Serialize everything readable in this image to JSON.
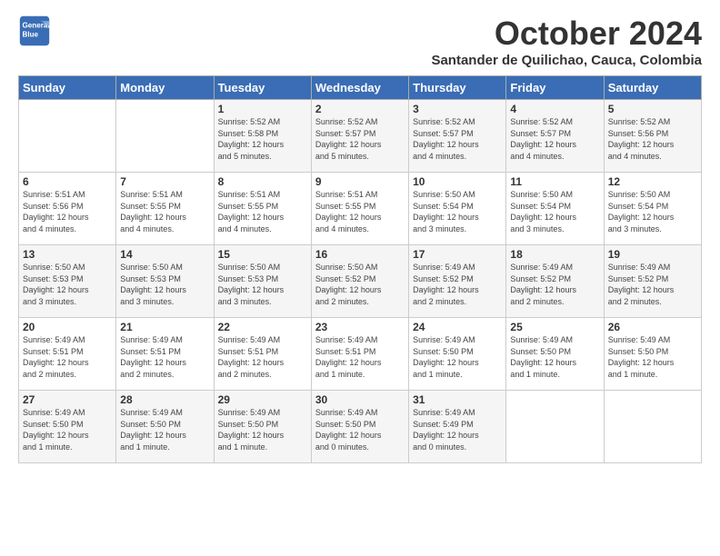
{
  "logo": {
    "line1": "General",
    "line2": "Blue"
  },
  "title": "October 2024",
  "subtitle": "Santander de Quilichao, Cauca, Colombia",
  "headers": [
    "Sunday",
    "Monday",
    "Tuesday",
    "Wednesday",
    "Thursday",
    "Friday",
    "Saturday"
  ],
  "weeks": [
    [
      {
        "day": "",
        "info": ""
      },
      {
        "day": "",
        "info": ""
      },
      {
        "day": "1",
        "info": "Sunrise: 5:52 AM\nSunset: 5:58 PM\nDaylight: 12 hours\nand 5 minutes."
      },
      {
        "day": "2",
        "info": "Sunrise: 5:52 AM\nSunset: 5:57 PM\nDaylight: 12 hours\nand 5 minutes."
      },
      {
        "day": "3",
        "info": "Sunrise: 5:52 AM\nSunset: 5:57 PM\nDaylight: 12 hours\nand 4 minutes."
      },
      {
        "day": "4",
        "info": "Sunrise: 5:52 AM\nSunset: 5:57 PM\nDaylight: 12 hours\nand 4 minutes."
      },
      {
        "day": "5",
        "info": "Sunrise: 5:52 AM\nSunset: 5:56 PM\nDaylight: 12 hours\nand 4 minutes."
      }
    ],
    [
      {
        "day": "6",
        "info": "Sunrise: 5:51 AM\nSunset: 5:56 PM\nDaylight: 12 hours\nand 4 minutes."
      },
      {
        "day": "7",
        "info": "Sunrise: 5:51 AM\nSunset: 5:55 PM\nDaylight: 12 hours\nand 4 minutes."
      },
      {
        "day": "8",
        "info": "Sunrise: 5:51 AM\nSunset: 5:55 PM\nDaylight: 12 hours\nand 4 minutes."
      },
      {
        "day": "9",
        "info": "Sunrise: 5:51 AM\nSunset: 5:55 PM\nDaylight: 12 hours\nand 4 minutes."
      },
      {
        "day": "10",
        "info": "Sunrise: 5:50 AM\nSunset: 5:54 PM\nDaylight: 12 hours\nand 3 minutes."
      },
      {
        "day": "11",
        "info": "Sunrise: 5:50 AM\nSunset: 5:54 PM\nDaylight: 12 hours\nand 3 minutes."
      },
      {
        "day": "12",
        "info": "Sunrise: 5:50 AM\nSunset: 5:54 PM\nDaylight: 12 hours\nand 3 minutes."
      }
    ],
    [
      {
        "day": "13",
        "info": "Sunrise: 5:50 AM\nSunset: 5:53 PM\nDaylight: 12 hours\nand 3 minutes."
      },
      {
        "day": "14",
        "info": "Sunrise: 5:50 AM\nSunset: 5:53 PM\nDaylight: 12 hours\nand 3 minutes."
      },
      {
        "day": "15",
        "info": "Sunrise: 5:50 AM\nSunset: 5:53 PM\nDaylight: 12 hours\nand 3 minutes."
      },
      {
        "day": "16",
        "info": "Sunrise: 5:50 AM\nSunset: 5:52 PM\nDaylight: 12 hours\nand 2 minutes."
      },
      {
        "day": "17",
        "info": "Sunrise: 5:49 AM\nSunset: 5:52 PM\nDaylight: 12 hours\nand 2 minutes."
      },
      {
        "day": "18",
        "info": "Sunrise: 5:49 AM\nSunset: 5:52 PM\nDaylight: 12 hours\nand 2 minutes."
      },
      {
        "day": "19",
        "info": "Sunrise: 5:49 AM\nSunset: 5:52 PM\nDaylight: 12 hours\nand 2 minutes."
      }
    ],
    [
      {
        "day": "20",
        "info": "Sunrise: 5:49 AM\nSunset: 5:51 PM\nDaylight: 12 hours\nand 2 minutes."
      },
      {
        "day": "21",
        "info": "Sunrise: 5:49 AM\nSunset: 5:51 PM\nDaylight: 12 hours\nand 2 minutes."
      },
      {
        "day": "22",
        "info": "Sunrise: 5:49 AM\nSunset: 5:51 PM\nDaylight: 12 hours\nand 2 minutes."
      },
      {
        "day": "23",
        "info": "Sunrise: 5:49 AM\nSunset: 5:51 PM\nDaylight: 12 hours\nand 1 minute."
      },
      {
        "day": "24",
        "info": "Sunrise: 5:49 AM\nSunset: 5:50 PM\nDaylight: 12 hours\nand 1 minute."
      },
      {
        "day": "25",
        "info": "Sunrise: 5:49 AM\nSunset: 5:50 PM\nDaylight: 12 hours\nand 1 minute."
      },
      {
        "day": "26",
        "info": "Sunrise: 5:49 AM\nSunset: 5:50 PM\nDaylight: 12 hours\nand 1 minute."
      }
    ],
    [
      {
        "day": "27",
        "info": "Sunrise: 5:49 AM\nSunset: 5:50 PM\nDaylight: 12 hours\nand 1 minute."
      },
      {
        "day": "28",
        "info": "Sunrise: 5:49 AM\nSunset: 5:50 PM\nDaylight: 12 hours\nand 1 minute."
      },
      {
        "day": "29",
        "info": "Sunrise: 5:49 AM\nSunset: 5:50 PM\nDaylight: 12 hours\nand 1 minute."
      },
      {
        "day": "30",
        "info": "Sunrise: 5:49 AM\nSunset: 5:50 PM\nDaylight: 12 hours\nand 0 minutes."
      },
      {
        "day": "31",
        "info": "Sunrise: 5:49 AM\nSunset: 5:49 PM\nDaylight: 12 hours\nand 0 minutes."
      },
      {
        "day": "",
        "info": ""
      },
      {
        "day": "",
        "info": ""
      }
    ]
  ]
}
